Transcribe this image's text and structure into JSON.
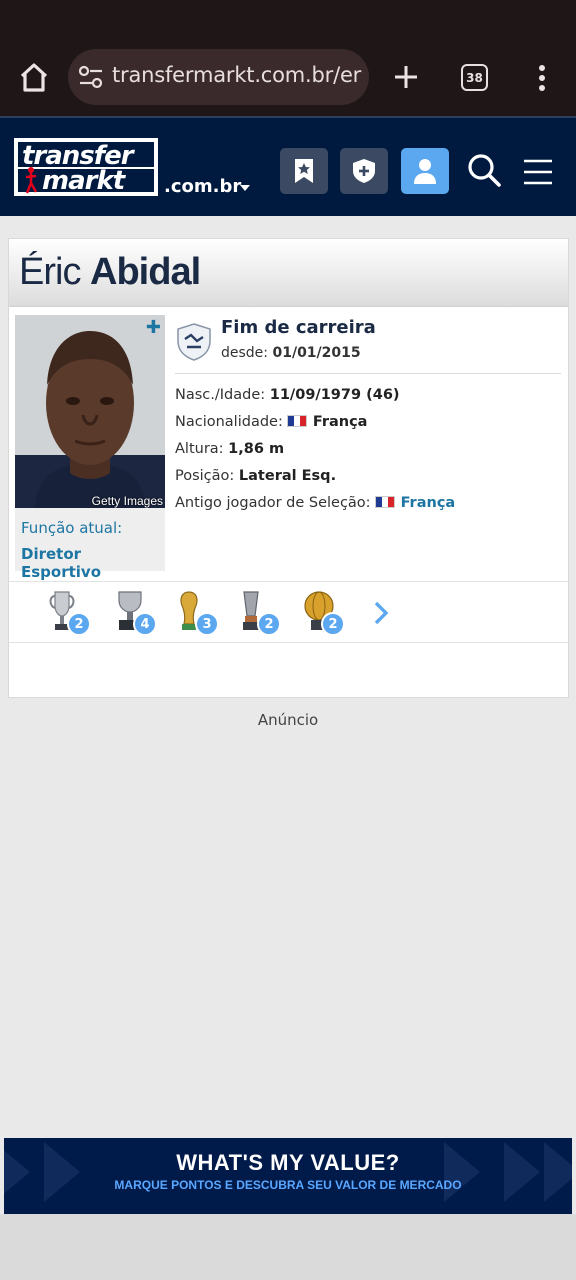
{
  "browser": {
    "url": "transfermarkt.com.br/eric",
    "tab_count": "38"
  },
  "header": {
    "logo_line1": "transfer",
    "logo_line2": "markt",
    "domain": ".com.br"
  },
  "player": {
    "first_name": "Éric",
    "last_name": "Abidal",
    "photo_credit": "Getty Images",
    "role_label": "Função atual:",
    "role_value": "Diretor Esportivo",
    "club_status": "Fim de carreira",
    "since_label": "desde:",
    "since_value": "01/01/2015",
    "info": {
      "birth_label": "Nasc./Idade:",
      "birth_value": "11/09/1979 (46)",
      "nationality_label": "Nacionalidade:",
      "nationality_value": "França",
      "height_label": "Altura:",
      "height_value": "1,86 m",
      "position_label": "Posição:",
      "position_value": "Lateral Esq.",
      "national_label": "Antigo jogador de Seleção:",
      "national_value": "França"
    }
  },
  "trophies": [
    {
      "name": "champions-league-trophy-icon",
      "count": "2"
    },
    {
      "name": "la-liga-trophy-icon",
      "count": "4"
    },
    {
      "name": "world-cup-trophy-icon",
      "count": "3"
    },
    {
      "name": "super-cup-trophy-icon",
      "count": "2"
    },
    {
      "name": "club-world-cup-trophy-icon",
      "count": "2"
    }
  ],
  "ad_label": "Anúncio",
  "banner": {
    "title": "WHAT'S MY VALUE?",
    "subtitle": "MARQUE PONTOS E DESCUBRA SEU VALOR DE MERCADO"
  },
  "colors": {
    "header_bg": "#001a3f",
    "accent": "#5ba8f0",
    "link": "#1d75a3"
  }
}
